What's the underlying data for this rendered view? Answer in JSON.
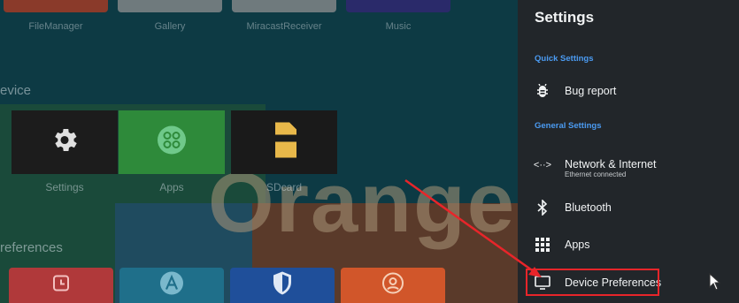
{
  "launcher": {
    "top_row_labels": [
      "FileManager",
      "Gallery",
      "MiracastReceiver",
      "Music"
    ],
    "section_device": "evice",
    "section_prefs": "references",
    "device_apps": [
      {
        "label": "Settings",
        "icon": "gear-icon"
      },
      {
        "label": "Apps",
        "icon": "apps-grid-icon"
      },
      {
        "label": "SDcard",
        "icon": "sdcard-icon"
      }
    ],
    "brand_text": "Orange p",
    "bottom_row_icons": [
      "clock-icon",
      "a-letter-icon",
      "shield-icon",
      "target-icon"
    ]
  },
  "settings_panel": {
    "title": "Settings",
    "section_quick": "Quick Settings",
    "section_general": "General Settings",
    "items": [
      {
        "label": "Bug report",
        "icon": "bug-icon"
      },
      {
        "label": "Network & Internet",
        "sublabel": "Ethernet connected",
        "icon": "network-arrows-icon",
        "icon_text": "<··>"
      },
      {
        "label": "Bluetooth",
        "icon": "bluetooth-icon"
      },
      {
        "label": "Apps",
        "icon": "apps-grid-icon"
      },
      {
        "label": "Device Preferences",
        "icon": "tv-icon"
      }
    ]
  },
  "colors": {
    "panel_bg": "#22262a",
    "section_accent": "#4b9bf2",
    "highlight": "#e8252a"
  }
}
